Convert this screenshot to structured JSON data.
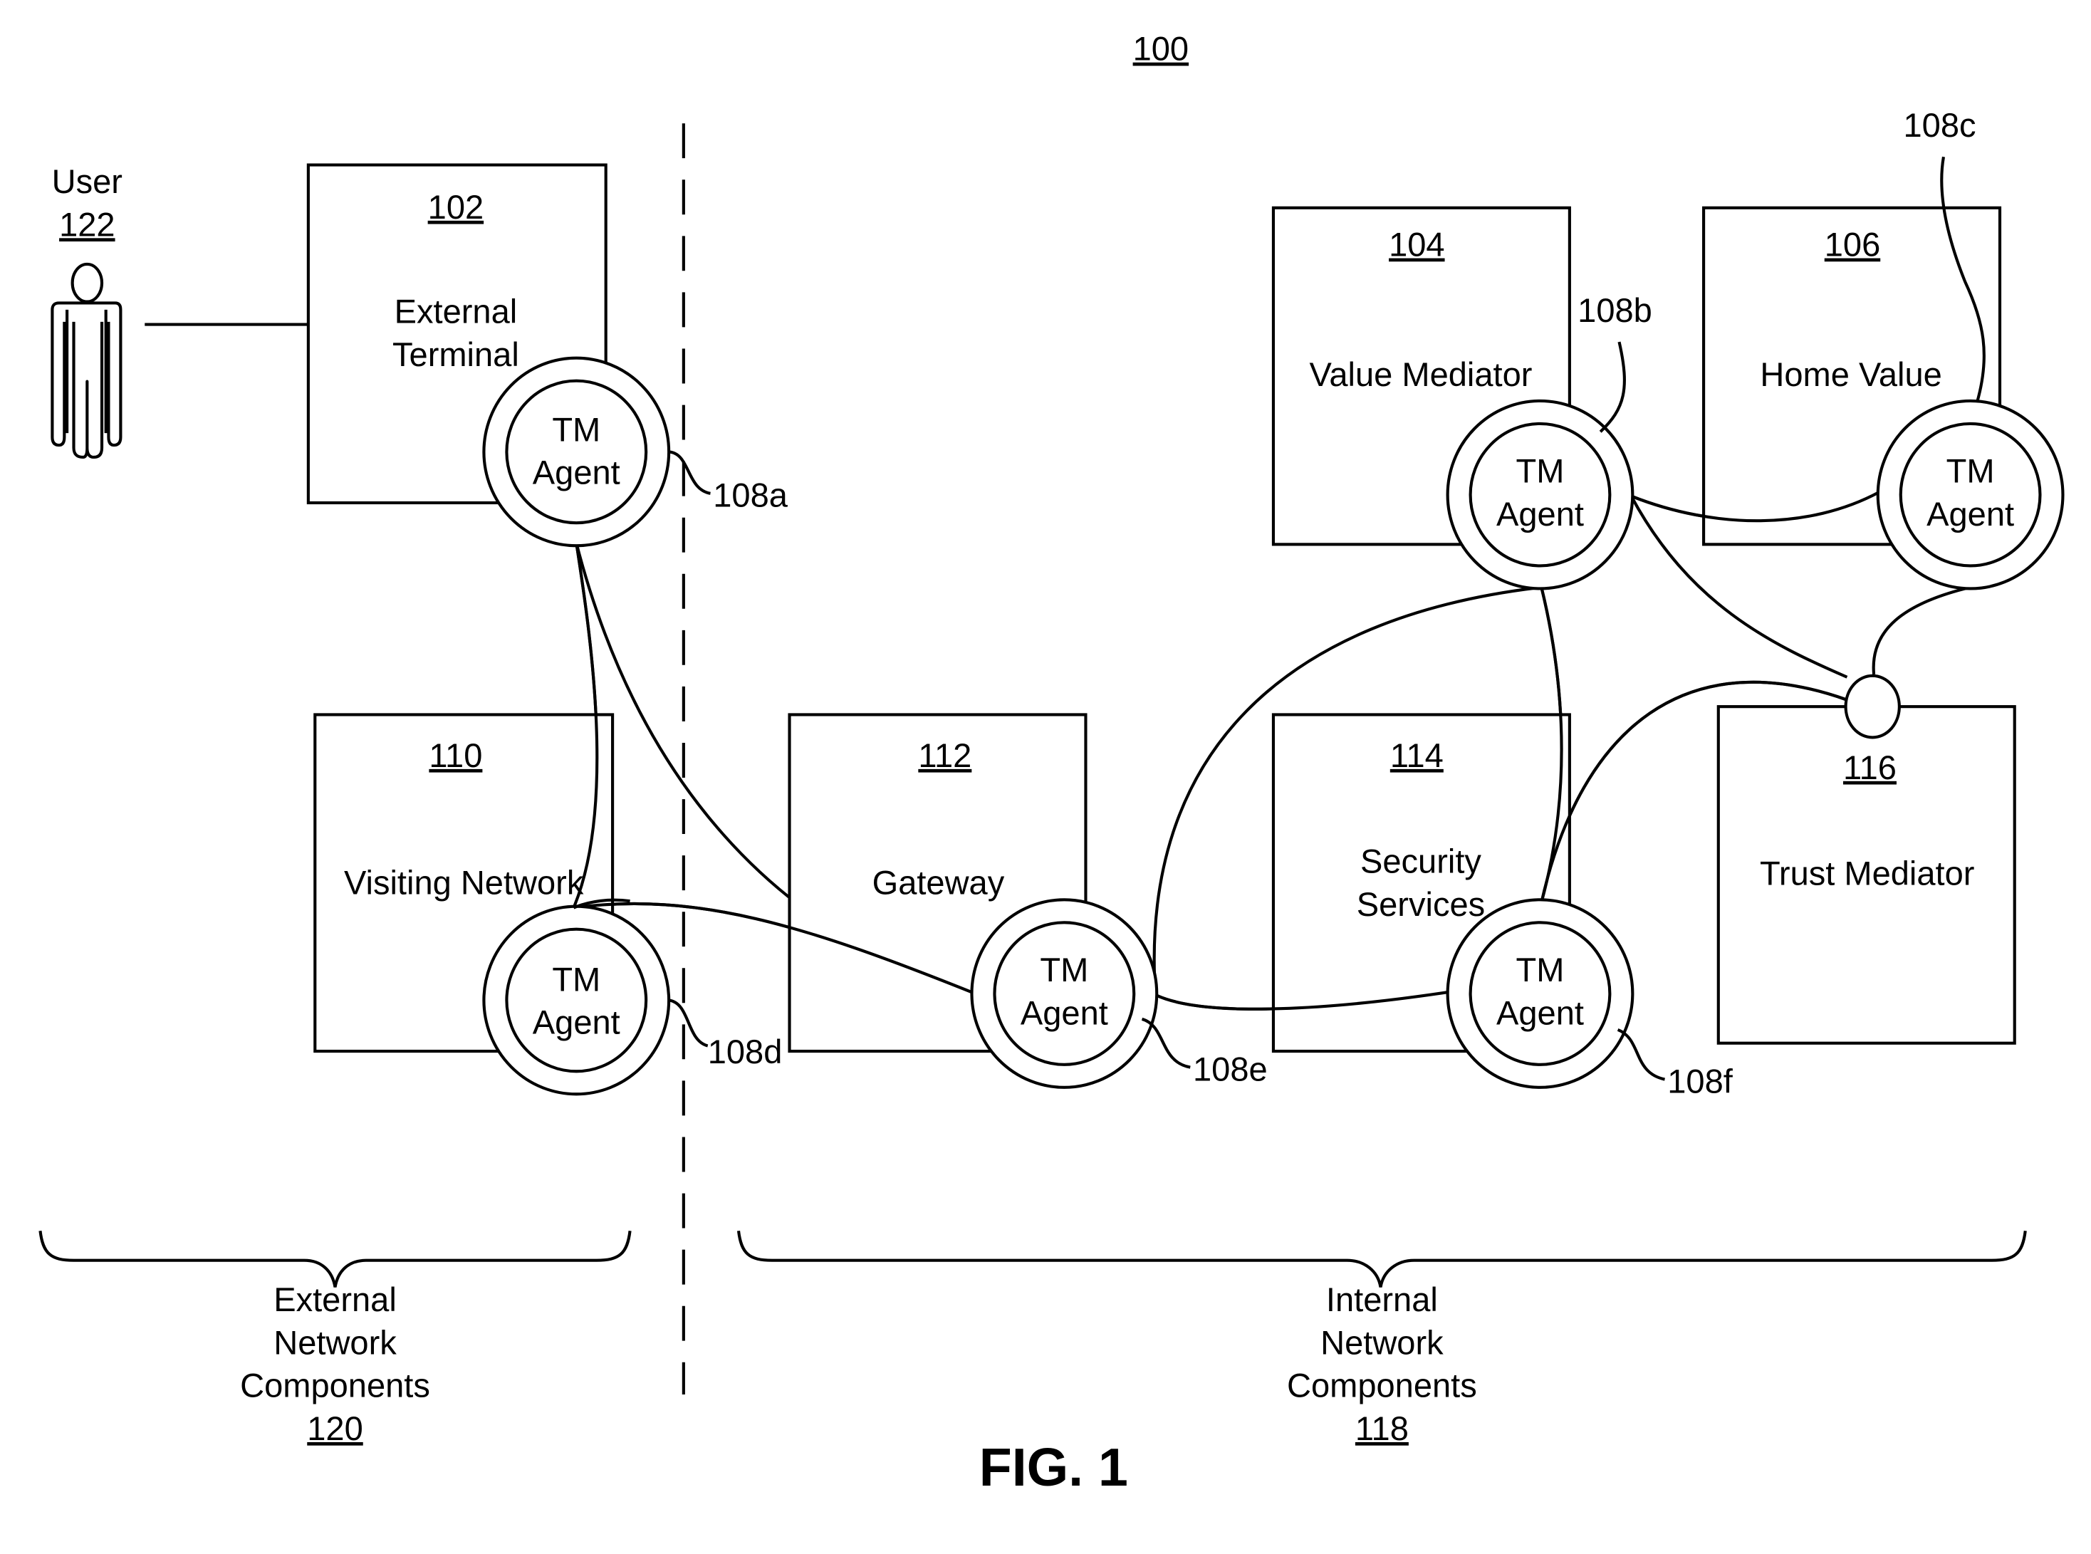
{
  "figure": {
    "ref": "100",
    "caption": "FIG. 1"
  },
  "user": {
    "label": "User",
    "ref": "122"
  },
  "components": {
    "external_terminal": {
      "ref": "102",
      "line1": "External",
      "line2": "Terminal"
    },
    "value_mediator": {
      "ref": "104",
      "label": "Value Mediator"
    },
    "home_value": {
      "ref": "106",
      "label": "Home Value"
    },
    "visiting_network": {
      "ref": "110",
      "label": "Visiting Network"
    },
    "gateway": {
      "ref": "112",
      "label": "Gateway"
    },
    "security_services": {
      "ref": "114",
      "line1": "Security",
      "line2": "Services"
    },
    "trust_mediator": {
      "ref": "116",
      "label": "Trust Mediator"
    }
  },
  "agents": {
    "line1": "TM",
    "line2": "Agent",
    "refs": {
      "a": "108a",
      "b": "108b",
      "c": "108c",
      "d": "108d",
      "e": "108e",
      "f": "108f"
    }
  },
  "groups": {
    "external": {
      "line1": "External",
      "line2": "Network",
      "line3": "Components",
      "ref": "120"
    },
    "internal": {
      "line1": "Internal",
      "line2": "Network",
      "line3": "Components",
      "ref": "118"
    }
  }
}
